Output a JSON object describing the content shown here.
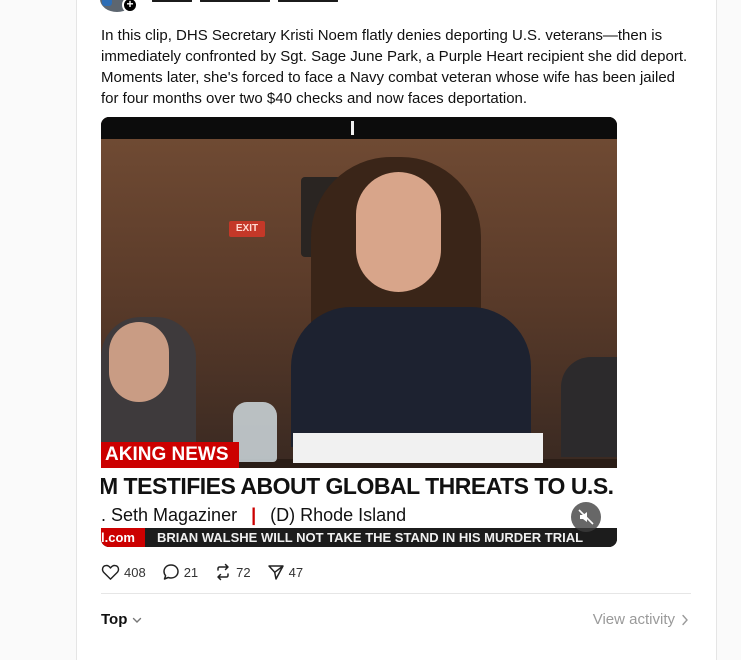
{
  "post": {
    "text": "In this clip, DHS Secretary Kristi Noem flatly denies deporting U.S. veterans—then is immediately confronted by Sgt. Sage June Park, a Purple Heart recipient she did deport. Moments later, she's forced to face a Navy combat veteran whose wife has been jailed for four months over two $40 checks and now faces deportation."
  },
  "video": {
    "exit_sign": "EXIT",
    "breaking_label": "AKING NEWS",
    "headline": "M TESTIFIES ABOUT GLOBAL THREATS TO U.S. AT ANNUAL HEARI",
    "subline_left": ". Seth Magaziner",
    "subline_right": "(D) Rhode Island",
    "ticker_site": "l.com",
    "ticker_text": "BRIAN WALSHE WILL NOT TAKE THE STAND IN HIS MURDER TRIAL",
    "mute_icon": "speaker-muted-icon"
  },
  "actions": {
    "likes": "408",
    "replies": "21",
    "reposts": "72",
    "shares": "47"
  },
  "footer": {
    "sort_label": "Top",
    "view_activity_label": "View activity"
  },
  "colors": {
    "breaking_red": "#cc0000",
    "muted_text": "#9a9a9a"
  }
}
